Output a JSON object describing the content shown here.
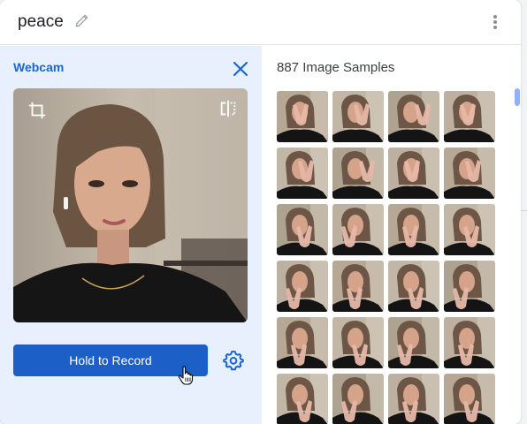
{
  "header": {
    "class_name": "peace"
  },
  "webcam": {
    "label": "Webcam",
    "record_label": "Hold to Record"
  },
  "samples": {
    "title": "887 Image Samples",
    "rows": 6,
    "cols": 4
  },
  "colors": {
    "accent": "#1967d2",
    "record_button": "#1b5fc7",
    "left_panel": "#e8f0fe"
  },
  "icons": [
    "edit-pencil-icon",
    "more-vert-icon",
    "close-icon",
    "crop-icon",
    "flip-icon",
    "settings-gear-icon",
    "hand-cursor-icon"
  ]
}
